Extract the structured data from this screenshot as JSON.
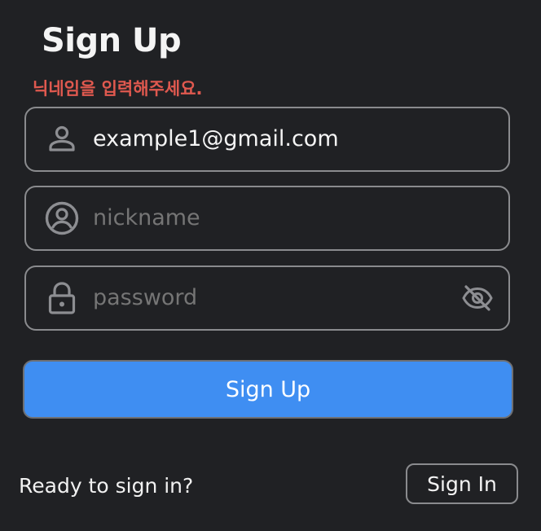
{
  "form": {
    "title": "Sign Up",
    "error_message": "닉네임을 입력해주세요.",
    "email": {
      "value": "example1@gmail.com",
      "icon": "person-icon"
    },
    "nickname": {
      "value": "",
      "placeholder": "nickname",
      "icon": "account-circle-icon"
    },
    "password": {
      "value": "",
      "placeholder": "password",
      "icon": "lock-icon",
      "toggle_icon": "eye-off-icon"
    },
    "submit_label": "Sign Up"
  },
  "footer": {
    "prompt": "Ready to sign in?",
    "signin_label": "Sign In"
  },
  "colors": {
    "background": "#202124",
    "error": "#e0594f",
    "primary": "#3f8ef2",
    "border": "#8a8b8e",
    "placeholder": "#8d8e92"
  }
}
